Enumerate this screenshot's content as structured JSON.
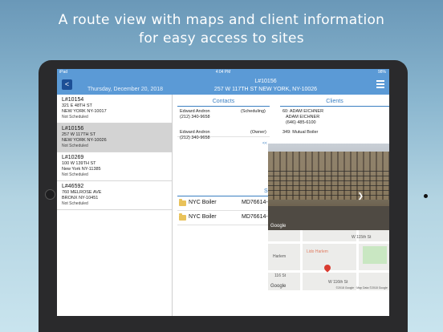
{
  "caption": {
    "line1": "A route view with maps and client information",
    "line2": "for easy access to sites"
  },
  "status_bar": {
    "carrier": "iPad",
    "time": "4:04 PM",
    "battery": "98%"
  },
  "nav": {
    "back_label": "<",
    "date": "Thursday, December 20, 2018",
    "title": "L#10156",
    "address": "257 W 117TH ST NEW YORK, NY-10026"
  },
  "jobs": [
    {
      "id": "L#10154",
      "addr1": "321 E 48TH ST",
      "addr2": "NEW YORK NY-10017",
      "status": "Not Scheduled"
    },
    {
      "id": "L#10156",
      "addr1": "257 W 117TH ST",
      "addr2": "NEW YORK NY-10026",
      "status": "Not Scheduled"
    },
    {
      "id": "L#10269",
      "addr1": "100 W 139TH ST",
      "addr2": "New York NY-11385",
      "status": "Not Scheduled"
    },
    {
      "id": "L#46592",
      "addr1": "760 MELROSE AVE",
      "addr2": "BRONX NY-10451",
      "status": "Not Scheduled"
    }
  ],
  "contacts": {
    "header": "Contacts",
    "items": [
      {
        "name": "Edward Andron",
        "role": "(Scheduling)",
        "phone": "(212) 340-9658"
      },
      {
        "name": "Edward Andron",
        "role": "(Owner)",
        "phone": "(212) 340-9658"
      }
    ]
  },
  "clients": {
    "header": "Clients",
    "lines": [
      "60: ADAM EICHNER",
      "ADAM EICHNER",
      "(646) 485-6100",
      "349: Mutual Boiler"
    ]
  },
  "equipment": {
    "header": "Se",
    "items": [
      {
        "name": "NYC Boiler",
        "code": "MD76614-"
      },
      {
        "name": "NYC Boiler",
        "code": "MD76614-"
      }
    ]
  },
  "street_view": {
    "logo": "Google"
  },
  "map": {
    "logo": "Google",
    "labels": [
      "Harlem",
      "Lido Harlem",
      "116 St",
      "W 116th St",
      "W 115th St"
    ],
    "copyright": "©2018 Google · Map Data ©2018 Google"
  },
  "colors": {
    "nav_bg": "#5b9ad6",
    "accent": "#3b7fc2",
    "back_btn": "#1c4f96",
    "selected_row": "#d3d3d3"
  }
}
